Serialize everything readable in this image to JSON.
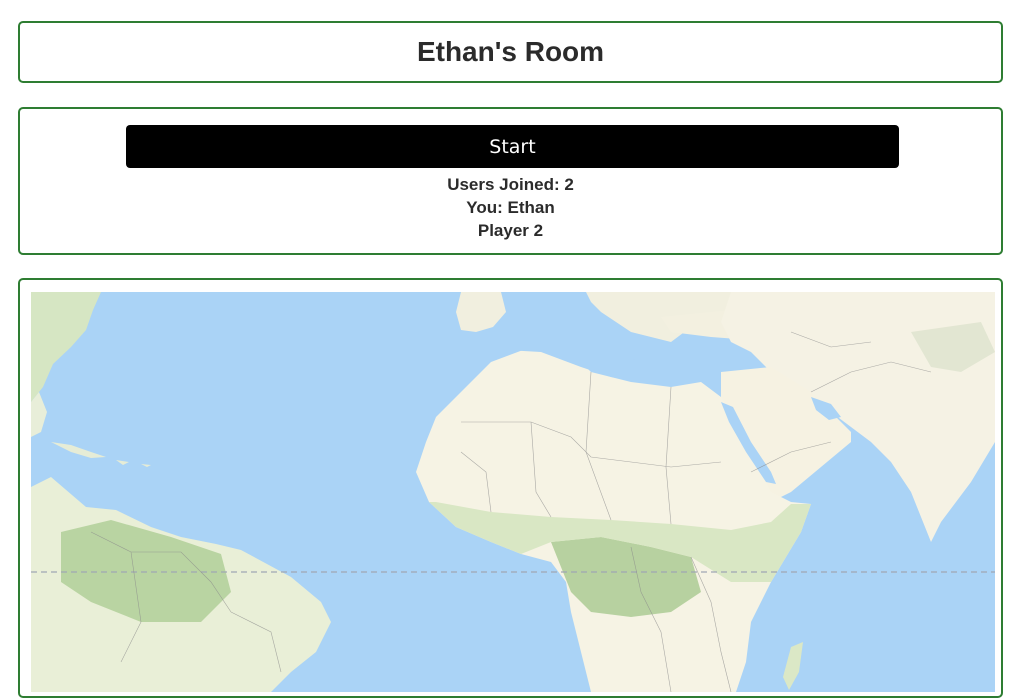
{
  "room": {
    "title": "Ethan's Room"
  },
  "controls": {
    "start_label": "Start",
    "users_joined": "Users Joined: 2",
    "you": "You: Ethan",
    "player": "Player 2"
  },
  "colors": {
    "panel_border": "#2e7d32",
    "button_bg": "#000000",
    "ocean": "#aad3f6",
    "land": "#f5f2e4",
    "vegetation": "#cfe1b9",
    "equator": "#a0a6b4"
  }
}
